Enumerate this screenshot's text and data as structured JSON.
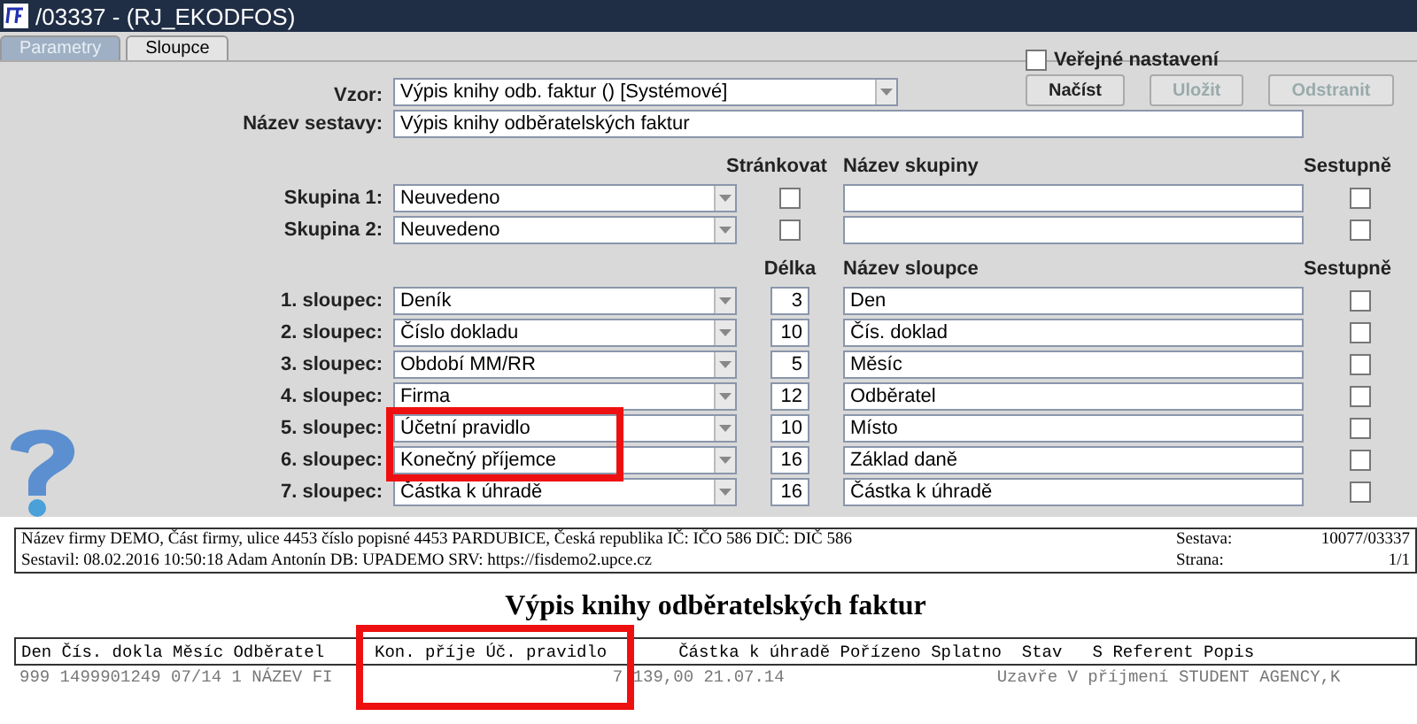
{
  "window": {
    "title": "/03337 - (RJ_EKODFOS)"
  },
  "tabs": [
    {
      "label": "Parametry",
      "selected": false
    },
    {
      "label": "Sloupce",
      "selected": true
    }
  ],
  "form": {
    "public_setting": {
      "label": "Veřejné nastavení",
      "checked": false
    },
    "template": {
      "label": "Vzor:",
      "value": "Výpis knihy odb. faktur   ()   [Systémové]"
    },
    "buttons": [
      {
        "label": "Načíst",
        "disabled": false
      },
      {
        "label": "Uložit",
        "disabled": true
      },
      {
        "label": "Odstranit",
        "disabled": true
      }
    ],
    "report_name": {
      "label": "Název sestavy:",
      "value": "Výpis knihy odběratelských faktur"
    },
    "group_headers": {
      "paging": "Stránkovat",
      "name": "Název skupiny",
      "descending": "Sestupně"
    },
    "groups": [
      {
        "label": "Skupina 1:",
        "value": "Neuvedeno",
        "paging": false,
        "descending": false
      },
      {
        "label": "Skupina 2:",
        "value": "Neuvedeno",
        "paging": false,
        "descending": false
      }
    ],
    "column_headers": {
      "length": "Délka",
      "name": "Název sloupce",
      "descending": "Sestupně"
    },
    "columns": [
      {
        "label": "1. sloupec:",
        "value": "Deník",
        "length": "3",
        "name": "Den",
        "descending": false,
        "highlighted": false
      },
      {
        "label": "2. sloupec:",
        "value": "Číslo dokladu",
        "length": "10",
        "name": "Čís. doklad",
        "descending": false,
        "highlighted": false
      },
      {
        "label": "3. sloupec:",
        "value": "Období MM/RR",
        "length": "5",
        "name": "Měsíc",
        "descending": false,
        "highlighted": false
      },
      {
        "label": "4. sloupec:",
        "value": "Firma",
        "length": "12",
        "name": "Odběratel",
        "descending": false,
        "highlighted": false
      },
      {
        "label": "5. sloupec:",
        "value": "Účetní pravidlo",
        "length": "10",
        "name": "Místo",
        "descending": false,
        "highlighted": true
      },
      {
        "label": "6. sloupec:",
        "value": "Konečný příjemce",
        "length": "16",
        "name": "Základ daně",
        "descending": false,
        "highlighted": true
      },
      {
        "label": "7. sloupec:",
        "value": "Částka k úhradě",
        "length": "16",
        "name": "Částka k úhradě",
        "descending": false,
        "highlighted": false
      }
    ]
  },
  "report": {
    "header_lines": [
      "Název firmy DEMO, Část firmy, ulice 4453 číslo popisné 4453 PARDUBICE, Česká republika  IČ: IČO 586  DIČ: DIČ 586",
      "Sestavil: 08.02.2016 10:50:18 Adam Antonín  DB: UPADEMO  SRV: https://fisdemo2.upce.cz"
    ],
    "info": [
      {
        "label": "Sestava:",
        "value": "10077/03337"
      },
      {
        "label": "Strana:",
        "value": "1/1"
      }
    ],
    "title": "Výpis knihy odběratelských faktur",
    "table_header": [
      {
        "text": "Den Čís. dokla Měsíc Odběratel",
        "highlighted": false
      },
      {
        "text": "Kon. příje Úč. pravidlo",
        "highlighted": true
      },
      {
        "text": "Částka k úhradě Pořízeno Splatno  Stav   S Referent Popis",
        "highlighted": false
      }
    ],
    "row": [
      "999 1499901249 07/14 1 NÁZEV FI",
      "7 139,00 21.07.14",
      "Uzavře V příjmení STUDENT AGENCY,K"
    ]
  }
}
